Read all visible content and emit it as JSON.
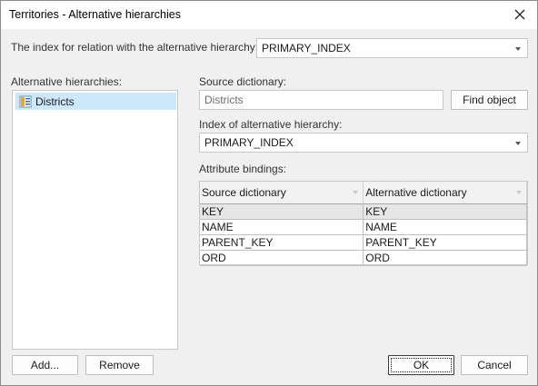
{
  "window": {
    "title": "Territories - Alternative hierarchies",
    "close_icon": "close-icon"
  },
  "index_relation": {
    "label": "The index for relation with the alternative hierarchy:",
    "value": "PRIMARY_INDEX"
  },
  "hierarchies": {
    "label": "Alternative hierarchies:",
    "items": [
      {
        "label": "Districts",
        "icon": "dictionary-icon",
        "selected": true
      }
    ],
    "add_label": "Add...",
    "remove_label": "Remove"
  },
  "source_dictionary": {
    "label": "Source dictionary:",
    "value": "Districts",
    "find_label": "Find object"
  },
  "alt_index": {
    "label": "Index of alternative hierarchy:",
    "value": "PRIMARY_INDEX"
  },
  "bindings": {
    "label": "Attribute bindings:",
    "columns": [
      "Source dictionary",
      "Alternative dictionary"
    ],
    "rows": [
      [
        "KEY",
        "KEY"
      ],
      [
        "NAME",
        "NAME"
      ],
      [
        "PARENT_KEY",
        "PARENT_KEY"
      ],
      [
        "ORD",
        "ORD"
      ]
    ]
  },
  "footer": {
    "ok_label": "OK",
    "cancel_label": "Cancel"
  }
}
